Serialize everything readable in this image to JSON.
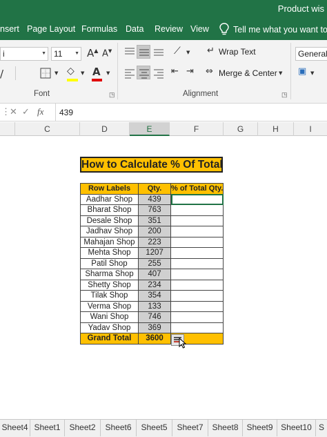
{
  "title_bar": {
    "title": "Product wis"
  },
  "ribbon_tabs": [
    "Insert",
    "Page Layout",
    "Formulas",
    "Data",
    "Review",
    "View"
  ],
  "ribbon_tabs_visible": [
    "nsert",
    "Page Layout",
    "Formulas",
    "Data",
    "Review",
    "View"
  ],
  "tell_me": "Tell me what you want to",
  "font": {
    "name": "i",
    "size": "11"
  },
  "alignment": {
    "wrap_text": "Wrap Text",
    "merge_center": "Merge & Center",
    "group_label": "Alignment"
  },
  "font_group_label": "Font",
  "number_format": "General",
  "formula_bar": {
    "fx": "fx",
    "value": "439"
  },
  "columns": [
    "C",
    "D",
    "E",
    "F",
    "G",
    "H",
    "I"
  ],
  "selected_column": "E",
  "heading": "How to Calculate % Of Total",
  "table": {
    "headers": [
      "Row Labels",
      "Qty.",
      "% of Total Qty."
    ],
    "rows": [
      [
        "Aadhar Shop",
        "439"
      ],
      [
        "Bharat Shop",
        "763"
      ],
      [
        "Desale Shop",
        "351"
      ],
      [
        "Jadhav Shop",
        "200"
      ],
      [
        "Mahajan Shop",
        "223"
      ],
      [
        "Mehta Shop",
        "1207"
      ],
      [
        "Patil Shop",
        "255"
      ],
      [
        "Sharma Shop",
        "407"
      ],
      [
        "Shetty Shop",
        "234"
      ],
      [
        "Tilak Shop",
        "354"
      ],
      [
        "Verma Shop",
        "133"
      ],
      [
        "Wani Shop",
        "746"
      ],
      [
        "Yadav Shop",
        "369"
      ]
    ],
    "total": [
      "Grand Total",
      "3600"
    ]
  },
  "sheet_tabs": [
    "Sheet4",
    "Sheet1",
    "Sheet2",
    "Sheet6",
    "Sheet5",
    "Sheet7",
    "Sheet8",
    "Sheet9",
    "Sheet10",
    "S"
  ],
  "colors": {
    "excel_green": "#217346",
    "accent_orange": "#ffc000"
  }
}
